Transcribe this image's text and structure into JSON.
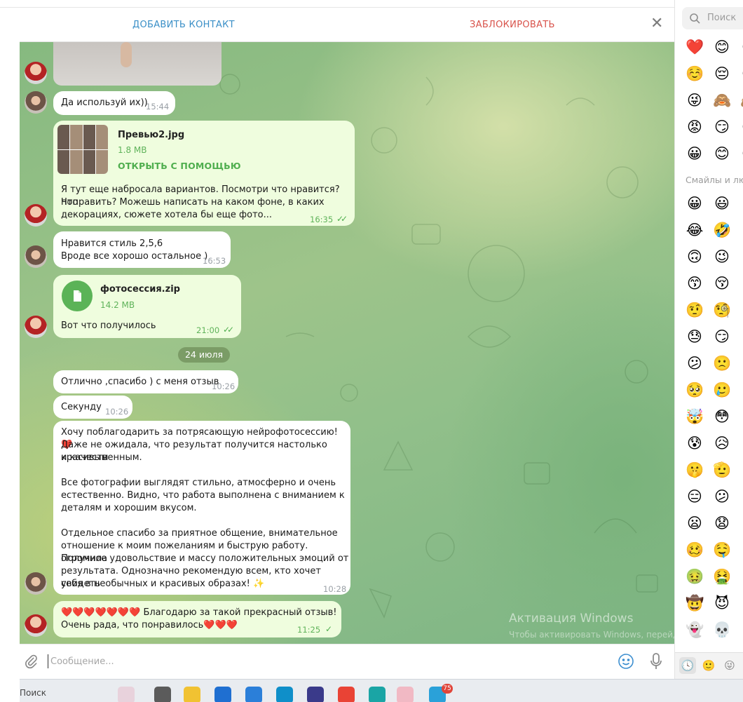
{
  "header": {
    "add_contact": "ДОБАВИТЬ КОНТАКТ",
    "block": "ЗАБЛОКИРОВАТЬ",
    "close": "✕"
  },
  "messages": [
    {
      "text": "Да используй их))",
      "time": "15:44"
    },
    {
      "file_name": "Превью2.jpg",
      "file_size": "1.8 MB",
      "open_with": "ОТКРЫТЬ С ПОМОЩЬЮ",
      "lines": [
        "Я тут еще набросала вариантов. Посмотри что нравится? Что",
        "поправить? Можешь написать на каком фоне, в каких",
        "декорациях, сюжете хотела бы еще фото..."
      ],
      "time": "16:35",
      "checks": "✓✓"
    },
    {
      "lines": [
        "Нравится стиль 2,5,6",
        "Вроде все хорошо остальное )"
      ],
      "time": "16:53"
    },
    {
      "file_name": "фотосессия.zip",
      "file_size": "14.2 MB",
      "text": "Вот что получилось",
      "time": "21:00",
      "checks": "✓✓"
    },
    {
      "text": "Отлично ,спасибо ) с меня отзыв",
      "time": "10:26"
    },
    {
      "text": "Секунду",
      "time": "10:26"
    },
    {
      "lines": [
        "Хочу поблагодарить за потрясающую нейрофотосессию! ❤️",
        "Даже не ожидала, что результат получится настолько красивым",
        "и качественным.",
        "",
        "Все фотографии выглядят стильно, атмосферно и очень",
        "естественно. Видно, что работа выполнена с вниманием к",
        "деталям и хорошим вкусом.",
        "",
        "Отдельное спасибо за приятное общение, внимательное",
        "отношение к моим пожеланиям и быструю работу. Получила",
        "огромное удовольствие и массу положительных эмоций от",
        "результата. Однозначно рекомендую всем, кто хочет увидеть",
        "себя в необычных и красивых образах! ✨"
      ],
      "time": "10:28"
    },
    {
      "lines": [
        "❤️❤️❤️❤️❤️❤️❤️ Благодарю за такой прекрасный отзыв!",
        "Очень рада, что понравилось❤️❤️❤️"
      ],
      "time": "11:25",
      "checks": "✓"
    }
  ],
  "date_divider": "24 июля",
  "watermark": {
    "title": "Активация Windows",
    "subtitle": "Чтобы активировать Windows, перейдите в раздел"
  },
  "composer": {
    "placeholder": "Сообщение..."
  },
  "emoji_panel": {
    "search_placeholder": "Поиск",
    "section_label": "Смайлы и лю",
    "recent": [
      [
        "❤️",
        "😊",
        "😊"
      ],
      [
        "☺️",
        "😔",
        "😔"
      ],
      [
        "😜",
        "🙈",
        "🙈"
      ],
      [
        "😡",
        "😏",
        "😏"
      ],
      [
        "😀",
        "😊",
        "😊"
      ]
    ],
    "smileys": [
      [
        "😀",
        "😃"
      ],
      [
        "😂",
        "🤣"
      ],
      [
        "🙃",
        "😉"
      ],
      [
        "😙",
        "😚"
      ],
      [
        "🤨",
        "🧐"
      ],
      [
        "😓",
        "😏"
      ],
      [
        "😕",
        "🙁"
      ],
      [
        "🥺",
        "🥲"
      ],
      [
        "🤯",
        "😳"
      ],
      [
        "😰",
        "😥"
      ],
      [
        "🤫",
        "🫡"
      ],
      [
        "😑",
        "😕"
      ],
      [
        "😦",
        "😧"
      ],
      [
        "🥴",
        "🤤"
      ],
      [
        "🤢",
        "🤮"
      ],
      [
        "🤠",
        "😈"
      ],
      [
        "👻",
        "💀"
      ]
    ],
    "footer_tabs": [
      "🕓",
      "🙂",
      "😜"
    ]
  },
  "taskbar": {
    "search_label": "Поиск",
    "badge": "75"
  }
}
